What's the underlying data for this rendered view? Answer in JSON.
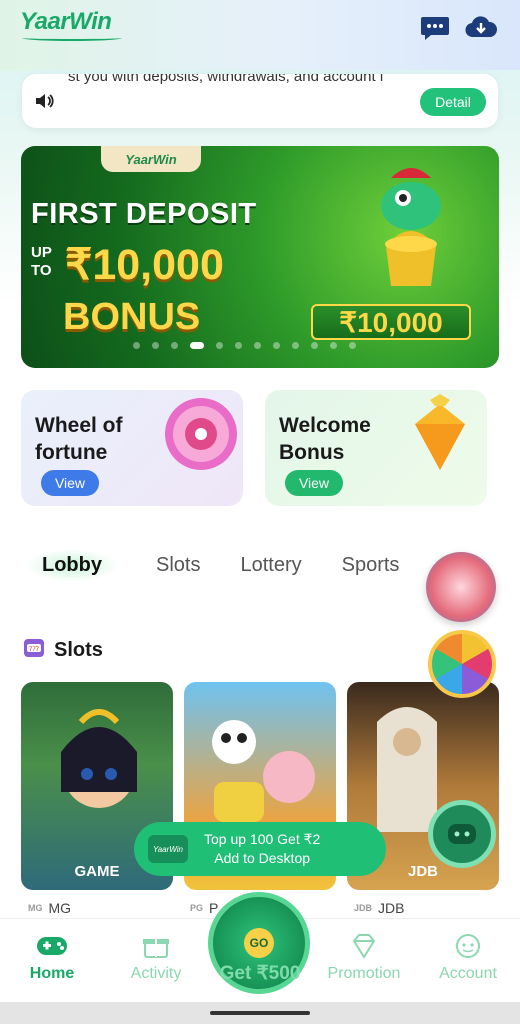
{
  "header": {
    "logo": "YaarWin",
    "icons": [
      "chat-icon",
      "download-icon"
    ]
  },
  "notice": {
    "text": "st you with deposits, withdrawals, and account i",
    "detail_label": "Detail"
  },
  "banner": {
    "logo": "YaarWin",
    "line1": "FIRST DEPOSIT",
    "upto": "UP TO",
    "amount": "₹10,000",
    "line3": "BONUS",
    "tag_amount": "₹10,000",
    "slide_count": 12,
    "active_slide": 3
  },
  "promo_cards": [
    {
      "title": "Wheel of fortune",
      "button": "View"
    },
    {
      "title": "Welcome Bonus",
      "button": "View"
    }
  ],
  "tabs": [
    "Lobby",
    "Slots",
    "Lottery",
    "Sports"
  ],
  "active_tab": "Lobby",
  "section": {
    "title": "Slots"
  },
  "games": [
    {
      "brand": "GAME",
      "provider_icon": "MG",
      "provider": "MG"
    },
    {
      "brand": "",
      "provider_icon": "PG",
      "provider": "P"
    },
    {
      "brand": "JDB",
      "provider_icon": "JDB",
      "provider": "JDB"
    }
  ],
  "add_to_home": {
    "logo": "YaarWin",
    "line1": "Top up 100 Get ₹2",
    "line2": "Add to Desktop"
  },
  "bottom_nav": {
    "items": [
      "Home",
      "Activity",
      "Promotion",
      "Account"
    ],
    "center_label": "Get ₹500",
    "center_badge": "GO"
  },
  "colors": {
    "brand": "#18a968",
    "accent": "#22c27a",
    "banner_gold": "#ffd84a"
  }
}
